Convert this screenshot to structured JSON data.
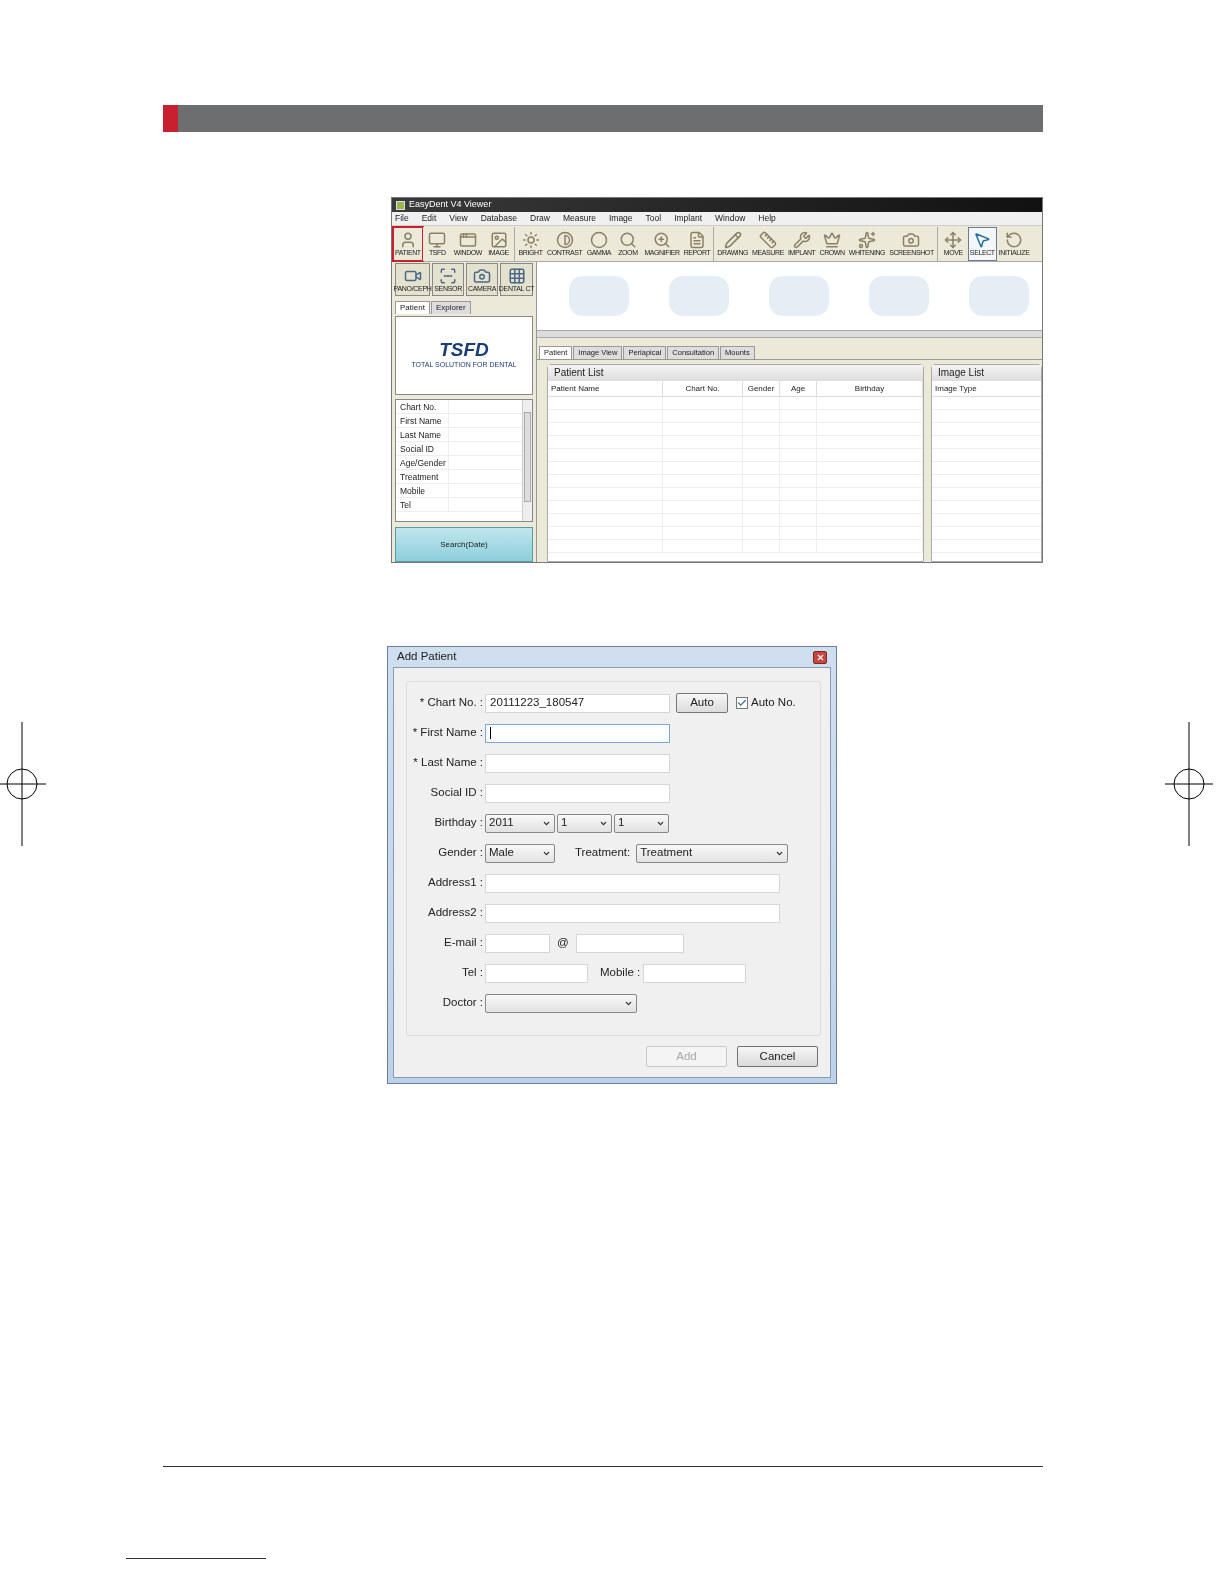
{
  "app": {
    "title": "EasyDent V4 Viewer",
    "menu": [
      "File",
      "Edit",
      "View",
      "Database",
      "Draw",
      "Measure",
      "Image",
      "Tool",
      "Implant",
      "Window",
      "Help"
    ],
    "toolbar_groups": [
      [
        {
          "label": "PATIENT",
          "selected": false,
          "highlighted": true
        },
        {
          "label": "TSFD",
          "selected": false,
          "highlighted": false
        },
        {
          "label": "WINDOW",
          "selected": false,
          "highlighted": false
        },
        {
          "label": "IMAGE",
          "selected": false,
          "highlighted": false
        }
      ],
      [
        {
          "label": "BRIGHT",
          "selected": false,
          "highlighted": false
        },
        {
          "label": "CONTRAST",
          "selected": false,
          "highlighted": false
        },
        {
          "label": "GAMMA",
          "selected": false,
          "highlighted": false
        },
        {
          "label": "ZOOM",
          "selected": false,
          "highlighted": false
        },
        {
          "label": "MAGNIFIER",
          "selected": false,
          "highlighted": false
        },
        {
          "label": "REPORT",
          "selected": false,
          "highlighted": false
        }
      ],
      [
        {
          "label": "DRAWING",
          "selected": false,
          "highlighted": false
        },
        {
          "label": "MEASURE",
          "selected": false,
          "highlighted": false
        },
        {
          "label": "IMPLANT",
          "selected": false,
          "highlighted": false
        },
        {
          "label": "CROWN",
          "selected": false,
          "highlighted": false
        },
        {
          "label": "WHITENING",
          "selected": false,
          "highlighted": false
        },
        {
          "label": "SCREENSHOT",
          "selected": false,
          "highlighted": false
        }
      ],
      [
        {
          "label": "MOVE",
          "selected": false,
          "highlighted": false
        },
        {
          "label": "SELECT",
          "selected": true,
          "highlighted": false
        },
        {
          "label": "INITIALIZE",
          "selected": false,
          "highlighted": false
        }
      ]
    ],
    "device_buttons": [
      "PANO/CEPH",
      "SENSOR",
      "CAMERA",
      "DENTAL CT"
    ],
    "side_tabs": [
      {
        "label": "Patient",
        "selected": true
      },
      {
        "label": "Explorer",
        "selected": false
      }
    ],
    "logo": {
      "name": "TSFD",
      "tagline": "TOTAL SOLUTION FOR DENTAL"
    },
    "info_fields": [
      "Chart No.",
      "First Name",
      "Last Name",
      "Social ID",
      "Age/Gender",
      "Treatment",
      "Mobile",
      "Tel"
    ],
    "search_button": "Search(Date)",
    "main_tabs": [
      {
        "label": "Patient",
        "selected": true
      },
      {
        "label": "Image View",
        "selected": false
      },
      {
        "label": "Periapical",
        "selected": false
      },
      {
        "label": "Consultation",
        "selected": false
      },
      {
        "label": "Mounts",
        "selected": false
      }
    ],
    "patient_list": {
      "title": "Patient List",
      "columns": [
        "Patient Name",
        "Chart No.",
        "Gender",
        "Age",
        "Birthday"
      ]
    },
    "image_list": {
      "title": "Image List",
      "columns": [
        "Image Type"
      ]
    }
  },
  "dialog": {
    "title": "Add Patient",
    "rows": [
      {
        "kind": "chart",
        "label": "* Chart No. :",
        "value": "20111223_180547",
        "button": "Auto",
        "checkbox": {
          "label": "Auto No.",
          "checked": true
        }
      },
      {
        "kind": "text",
        "label": "* First Name :",
        "focused": true
      },
      {
        "kind": "text",
        "label": "* Last Name :",
        "focused": false
      },
      {
        "kind": "text",
        "label": "Social ID :",
        "focused": false
      },
      {
        "kind": "date",
        "label": "Birthday :",
        "values": [
          "2011",
          "1",
          "1"
        ]
      },
      {
        "kind": "gender",
        "label": "Gender :",
        "value": "Male",
        "treatment_label": "Treatment:",
        "treatment_value": "Treatment"
      },
      {
        "kind": "wide",
        "label": "Address1 :"
      },
      {
        "kind": "wide",
        "label": "Address2 :"
      },
      {
        "kind": "email",
        "label": "E-mail :",
        "at": "@"
      },
      {
        "kind": "phone",
        "label": "Tel :",
        "mobile_label": "Mobile :"
      },
      {
        "kind": "select",
        "label": "Doctor :"
      }
    ],
    "buttons": [
      {
        "label": "Add",
        "disabled": true
      },
      {
        "label": "Cancel",
        "disabled": false
      }
    ]
  }
}
